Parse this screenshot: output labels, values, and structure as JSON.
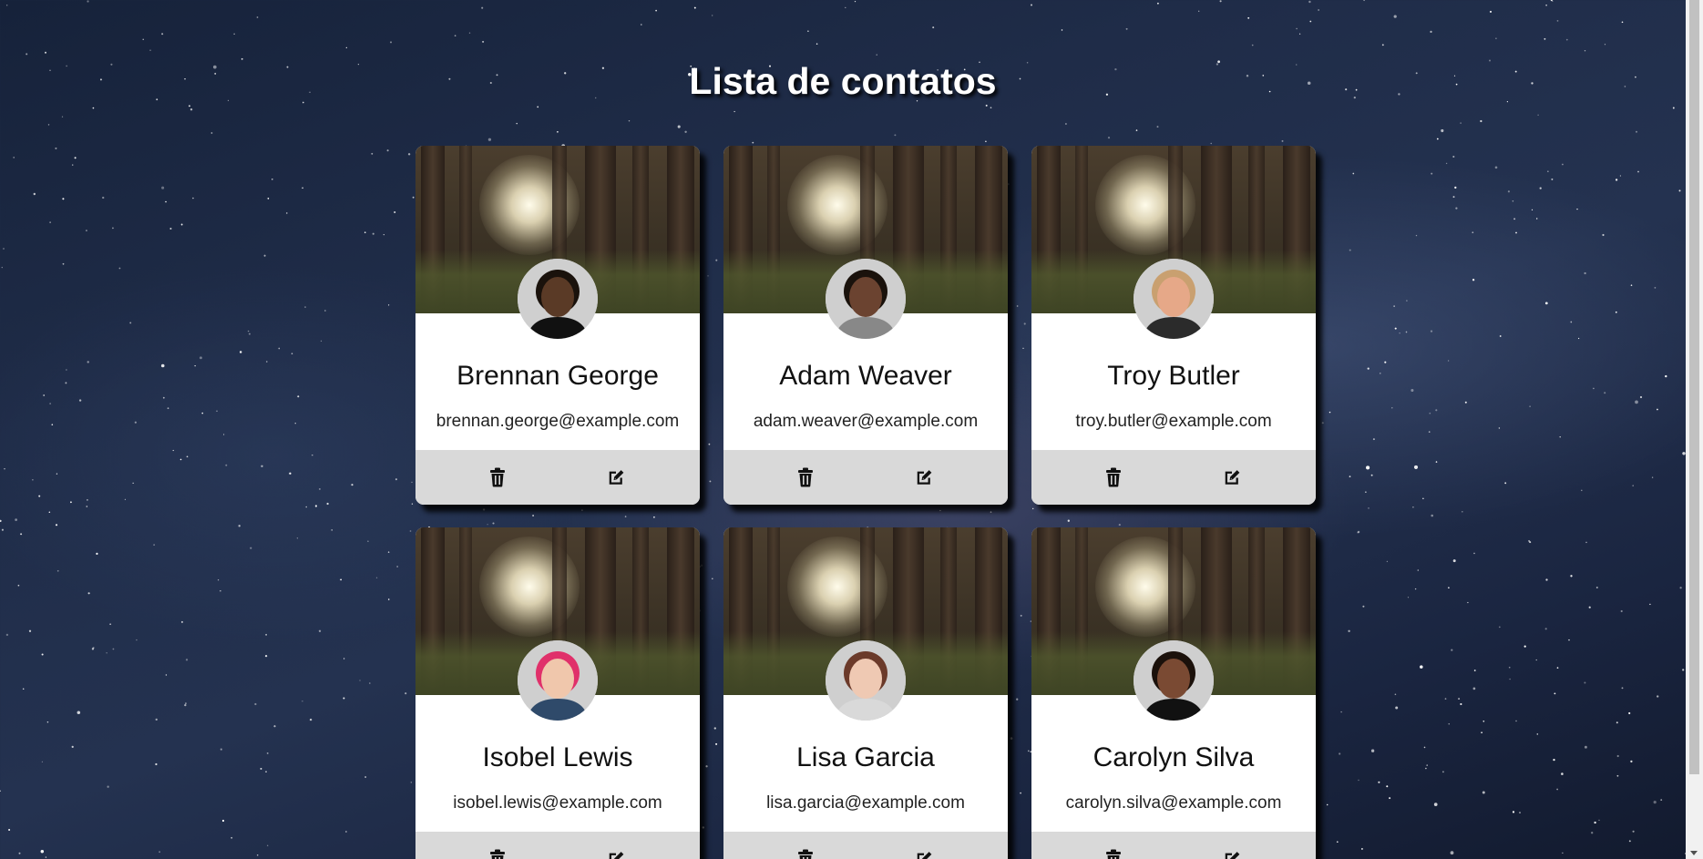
{
  "page": {
    "title": "Lista de contatos"
  },
  "contacts": [
    {
      "name": "Brennan George",
      "email": "brennan.george@example.com",
      "skin": "#5a3a26",
      "hair": "#1a120c",
      "shirt": "#111111"
    },
    {
      "name": "Adam Weaver",
      "email": "adam.weaver@example.com",
      "skin": "#6b4330",
      "hair": "#1a120c",
      "shirt": "#888888"
    },
    {
      "name": "Troy Butler",
      "email": "troy.butler@example.com",
      "skin": "#e6a888",
      "hair": "#c9a070",
      "shirt": "#2b2b2b"
    },
    {
      "name": "Isobel Lewis",
      "email": "isobel.lewis@example.com",
      "skin": "#f0c7ac",
      "hair": "#e0306a",
      "shirt": "#2f4a6a"
    },
    {
      "name": "Lisa Garcia",
      "email": "lisa.garcia@example.com",
      "skin": "#efc9b3",
      "hair": "#6b3a2a",
      "shirt": "#d9d9d9"
    },
    {
      "name": "Carolyn Silva",
      "email": "carolyn.silva@example.com",
      "skin": "#7a4a33",
      "hair": "#1b110b",
      "shirt": "#111111"
    }
  ],
  "actions": {
    "delete_icon": "trash-icon",
    "edit_icon": "pencil-square-icon"
  }
}
